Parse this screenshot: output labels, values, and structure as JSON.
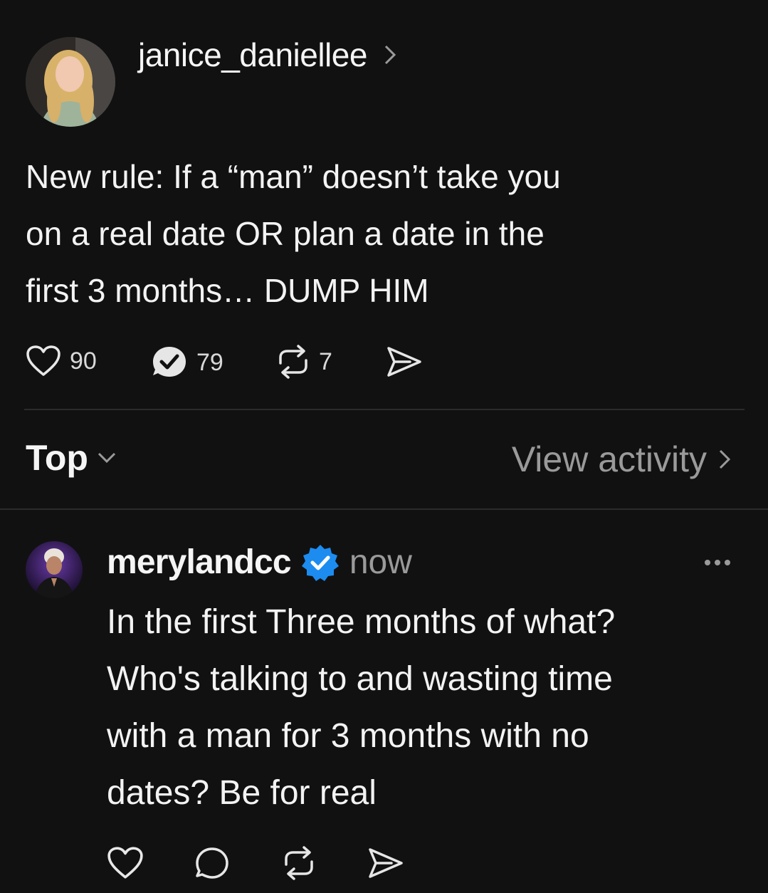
{
  "post": {
    "author": "janice_daniellee",
    "text_lines": [
      "New rule: If a “man” doesn’t take you",
      "on a real date OR plan a date in the",
      "first 3 months… DUMP HIM"
    ],
    "likes": "90",
    "replies": "79",
    "reposts": "7"
  },
  "filter": {
    "sort_label": "Top",
    "view_activity_label": "View activity"
  },
  "reply": {
    "author": "merylandcc",
    "timestamp": "now",
    "text_lines": [
      "In the first Three months of what?",
      "Who's talking to and wasting time",
      "with a man for 3 months with no",
      "dates? Be for real"
    ]
  },
  "colors": {
    "background": "#111112",
    "verified": "#1d8cf0",
    "muted_text": "#9a9a9a",
    "divider": "#2b2b2b"
  }
}
